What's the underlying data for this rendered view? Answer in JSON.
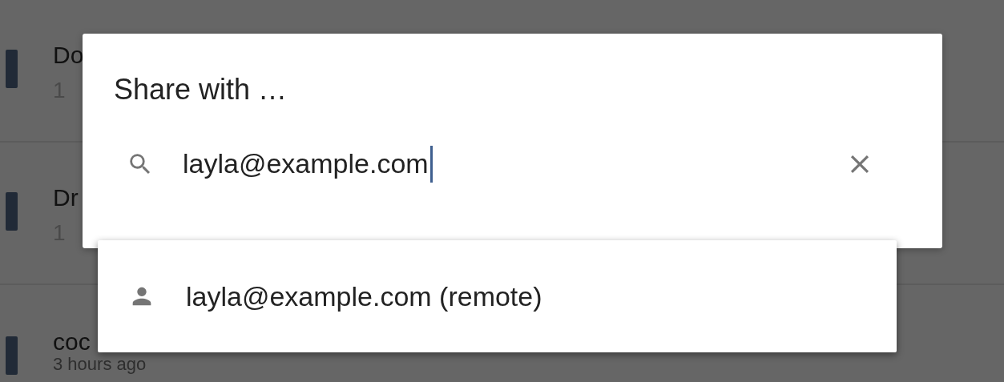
{
  "background_list": {
    "items": [
      {
        "title": "Do",
        "subtitle": "1"
      },
      {
        "title": "Dr",
        "subtitle": "1"
      },
      {
        "title": "coc",
        "subtitle": "3 hours ago"
      }
    ]
  },
  "dialog": {
    "title": "Share with …",
    "search": {
      "value": "layla@example.com"
    },
    "suggestions": [
      {
        "label": "layla@example.com (remote)"
      }
    ]
  }
}
